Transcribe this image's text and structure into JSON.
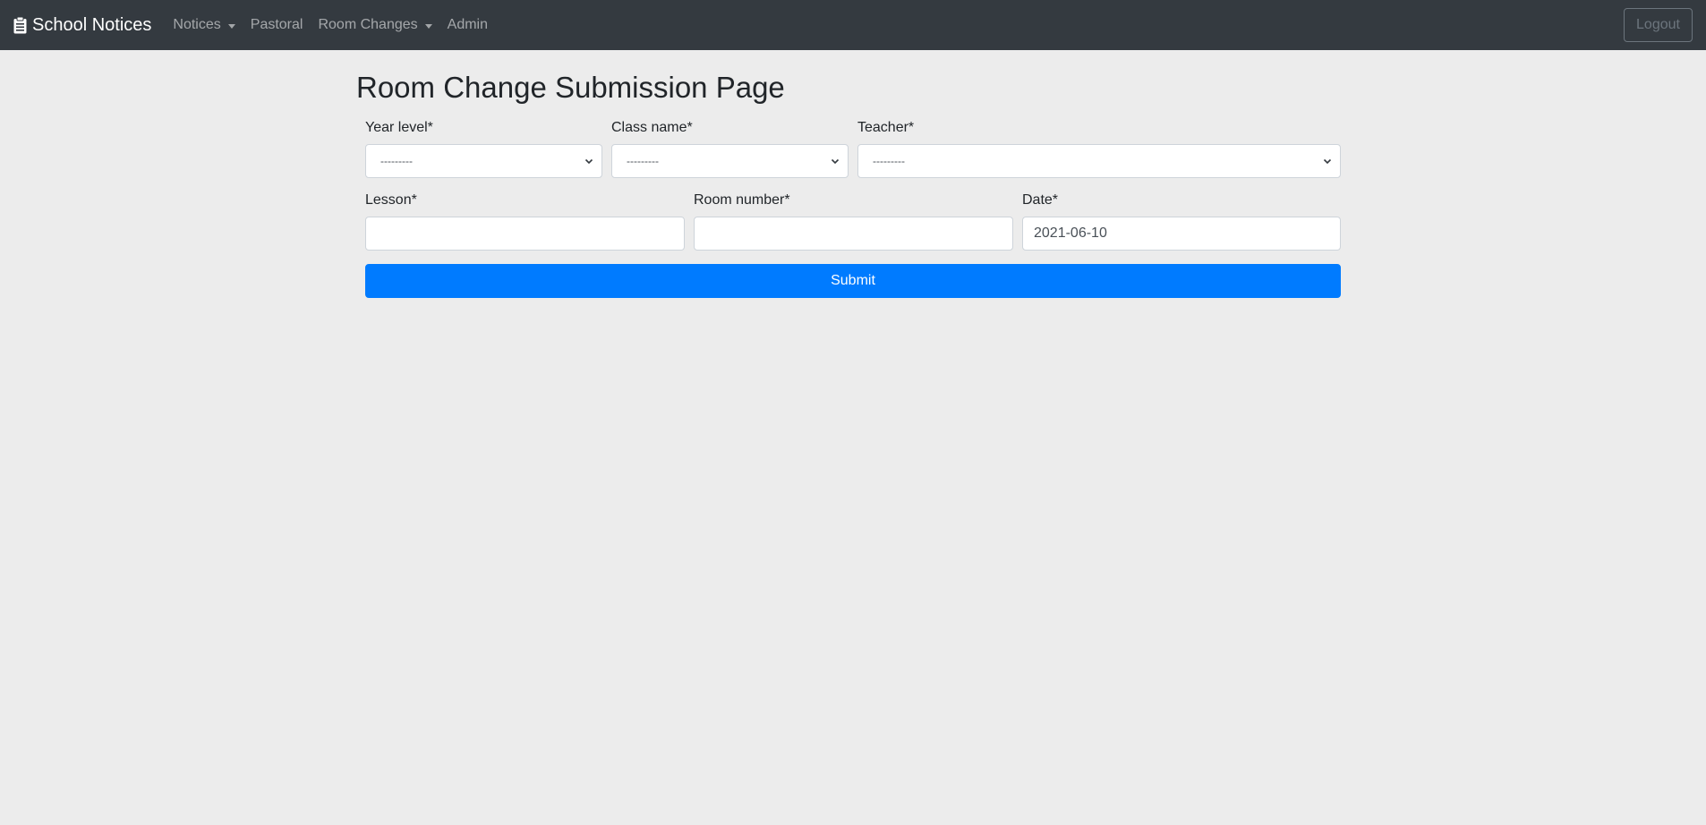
{
  "navbar": {
    "brand": "School Notices",
    "brand_icon": "clipboard-icon",
    "items": [
      {
        "label": "Notices",
        "dropdown": true
      },
      {
        "label": "Pastoral",
        "dropdown": false
      },
      {
        "label": "Room Changes",
        "dropdown": true
      },
      {
        "label": "Admin",
        "dropdown": false
      }
    ],
    "logout_label": "Logout"
  },
  "page": {
    "title": "Room Change Submission Page"
  },
  "form": {
    "year_level": {
      "label": "Year level*",
      "value": "---------"
    },
    "class_name": {
      "label": "Class name*",
      "value": "---------"
    },
    "teacher": {
      "label": "Teacher*",
      "value": "---------"
    },
    "lesson": {
      "label": "Lesson*",
      "value": ""
    },
    "room_number": {
      "label": "Room number*",
      "value": ""
    },
    "date": {
      "label": "Date*",
      "value": "2021-06-10"
    },
    "submit_label": "Submit"
  },
  "colors": {
    "navbar_bg": "#343a40",
    "page_bg": "#ececec",
    "primary": "#007bff"
  }
}
